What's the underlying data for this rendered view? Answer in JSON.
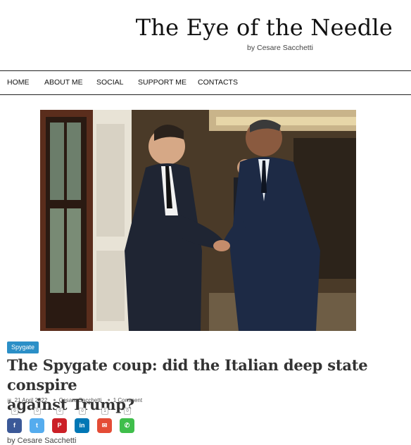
{
  "header": {
    "site_title": "The Eye of the Needle",
    "tagline": "by Cesare Sacchetti"
  },
  "nav": {
    "items": [
      {
        "label": "HOME"
      },
      {
        "label": "ABOUT ME"
      },
      {
        "label": "SOCIAL"
      },
      {
        "label": "SUPPORT ME"
      },
      {
        "label": "CONTACTS"
      }
    ]
  },
  "post": {
    "category": "Spygate",
    "title_line1": "The Spygate coup: did the Italian deep state conspire",
    "title_line2": "against Trump?",
    "date": "21 April 2022",
    "author": "Cesare Sacchetti",
    "comments": "1 Comment",
    "byline": "by Cesare Sacchetti",
    "share_counts": [
      "0",
      "0",
      "0",
      "0",
      "1",
      "0"
    ],
    "share_buttons": [
      {
        "name": "facebook",
        "glyph": "f",
        "color": "#3b5998"
      },
      {
        "name": "twitter",
        "glyph": "t",
        "color": "#55acee"
      },
      {
        "name": "pinterest",
        "glyph": "P",
        "color": "#cb2027"
      },
      {
        "name": "linkedin",
        "glyph": "in",
        "color": "#0077b5"
      },
      {
        "name": "email",
        "glyph": "✉",
        "color": "#e44c36"
      },
      {
        "name": "whatsapp",
        "glyph": "✆",
        "color": "#3fbe4b"
      }
    ],
    "meta_icons": {
      "date": "calendar-icon",
      "author": "user-icon",
      "comments": "comment-icon"
    }
  }
}
